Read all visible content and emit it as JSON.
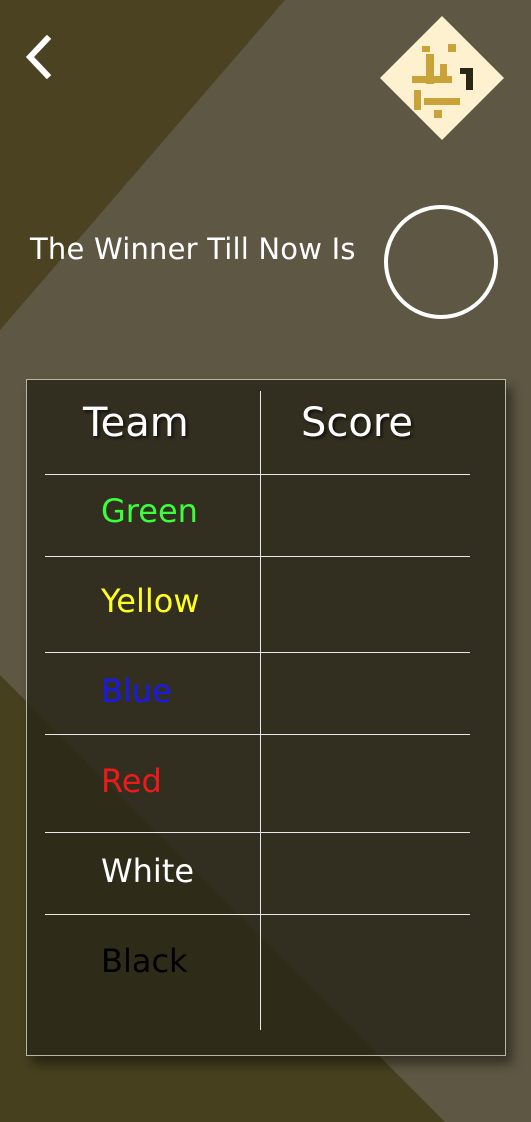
{
  "header": {
    "back_icon": "chevron-left-icon",
    "logo_icon": "app-logo-icon"
  },
  "winner": {
    "label": "The Winner Till Now Is",
    "value": ""
  },
  "table": {
    "headers": {
      "team": "Team",
      "score": "Score"
    },
    "rows": [
      {
        "team": "Green",
        "color": "#3bff3b",
        "score": ""
      },
      {
        "team": "Yellow",
        "color": "#ffff1f",
        "score": ""
      },
      {
        "team": "Blue",
        "color": "#1a1ae6",
        "score": ""
      },
      {
        "team": "Red",
        "color": "#ee1a1a",
        "score": ""
      },
      {
        "team": "White",
        "color": "#ffffff",
        "score": ""
      },
      {
        "team": "Black",
        "color": "#000000",
        "score": ""
      }
    ]
  },
  "colors": {
    "background": "#5e5743",
    "dark_band": "#47401f",
    "board": "#2a2719"
  }
}
